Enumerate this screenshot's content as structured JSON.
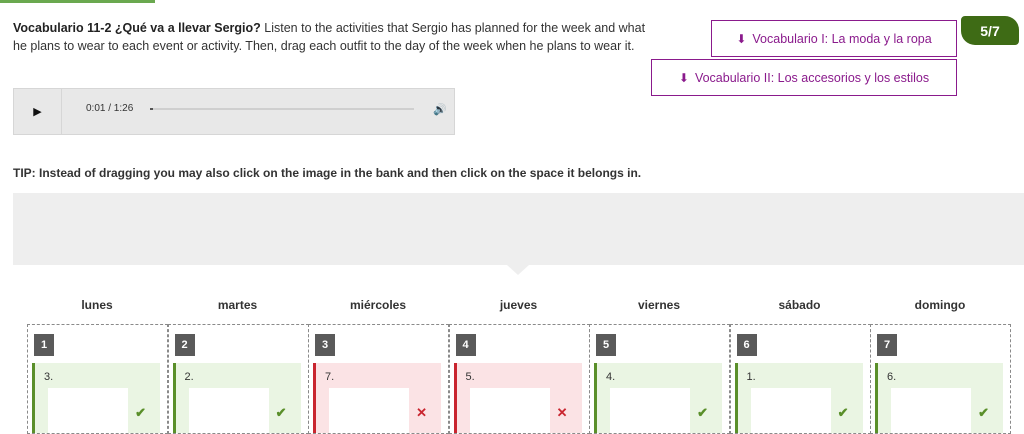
{
  "instructions": {
    "title": "Vocabulario 11-2 ¿Qué va a llevar Sergio?",
    "body": " Listen to the activities that Sergio has planned for the week and what he plans to wear to each event or activity. Then, drag each outfit to the day of the week when he plans to wear it."
  },
  "buttons": {
    "vocab1": "Vocabulario I: La moda y la ropa",
    "vocab2": "Vocabulario II: Los accesorios y los estilos"
  },
  "counter": "5/7",
  "audio": {
    "current": "0:01",
    "duration": "1:26",
    "time_text": "0:01 / 1:26",
    "progress": 0.012,
    "play_icon": "play-icon",
    "volume_icon": "volume-icon"
  },
  "tip": "TIP: Instead of dragging you may also click on the image in the bank and then click on the space it belongs in.",
  "colors": {
    "accent": "#8a1a8c",
    "counter_bg": "#3e6b15",
    "correct": "#5a8f2a",
    "incorrect": "#c9252f"
  },
  "days": [
    {
      "day": "lunes",
      "slot": "1",
      "answer": "3.",
      "correct": true
    },
    {
      "day": "martes",
      "slot": "2",
      "answer": "2.",
      "correct": true
    },
    {
      "day": "miércoles",
      "slot": "3",
      "answer": "7.",
      "correct": false
    },
    {
      "day": "jueves",
      "slot": "4",
      "answer": "5.",
      "correct": false
    },
    {
      "day": "viernes",
      "slot": "5",
      "answer": "4.",
      "correct": true
    },
    {
      "day": "sábado",
      "slot": "6",
      "answer": "1.",
      "correct": true
    },
    {
      "day": "domingo",
      "slot": "7",
      "answer": "6.",
      "correct": true
    }
  ],
  "marks": {
    "correct": "✔",
    "incorrect": "✕"
  },
  "images": [
    "hoodie-and-jacket-image",
    "blue-jacket-image",
    "red-shirt-and-shorts-image",
    "blue-tshirt-image",
    "sneakers-image",
    "sandals-and-bag-image",
    "leather-jacket-image"
  ]
}
